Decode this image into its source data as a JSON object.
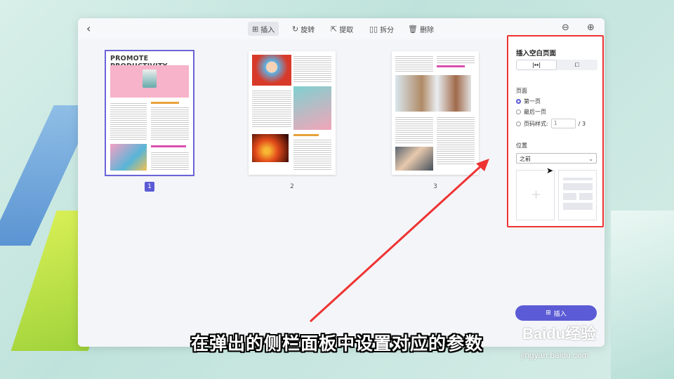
{
  "toolbar": {
    "back": "‹",
    "tools": [
      {
        "label": "插入",
        "icon": "insert-icon",
        "active": true
      },
      {
        "label": "旋转",
        "icon": "rotate-icon",
        "active": false
      },
      {
        "label": "提取",
        "icon": "extract-icon",
        "active": false
      },
      {
        "label": "拆分",
        "icon": "split-icon",
        "active": false
      },
      {
        "label": "删除",
        "icon": "delete-icon",
        "active": false
      }
    ],
    "zoom_out": "⊖",
    "zoom_in": "⊕"
  },
  "pages": [
    {
      "number": "1",
      "title": "PROMOTE PRODUCTIVITY",
      "selected": true
    },
    {
      "number": "2",
      "selected": false
    },
    {
      "number": "3",
      "selected": false
    }
  ],
  "panel": {
    "title": "插入空白页面",
    "seg_left": "|↔|",
    "seg_right": "⧠",
    "page_label": "页面",
    "options": [
      "第一页",
      "最后一页",
      "页码样式:"
    ],
    "page_input_value": "1",
    "page_total": "/ 3",
    "position_label": "位置",
    "position_value": "之前",
    "insert_button": "插入"
  },
  "subtitle": "在弹出的侧栏面板中设置对应的参数",
  "watermark": {
    "brand": "Baidu经验",
    "url": "jingyan.baidu.com"
  },
  "colors": {
    "accent": "#5b5bd6",
    "highlight": "#ee3333"
  }
}
